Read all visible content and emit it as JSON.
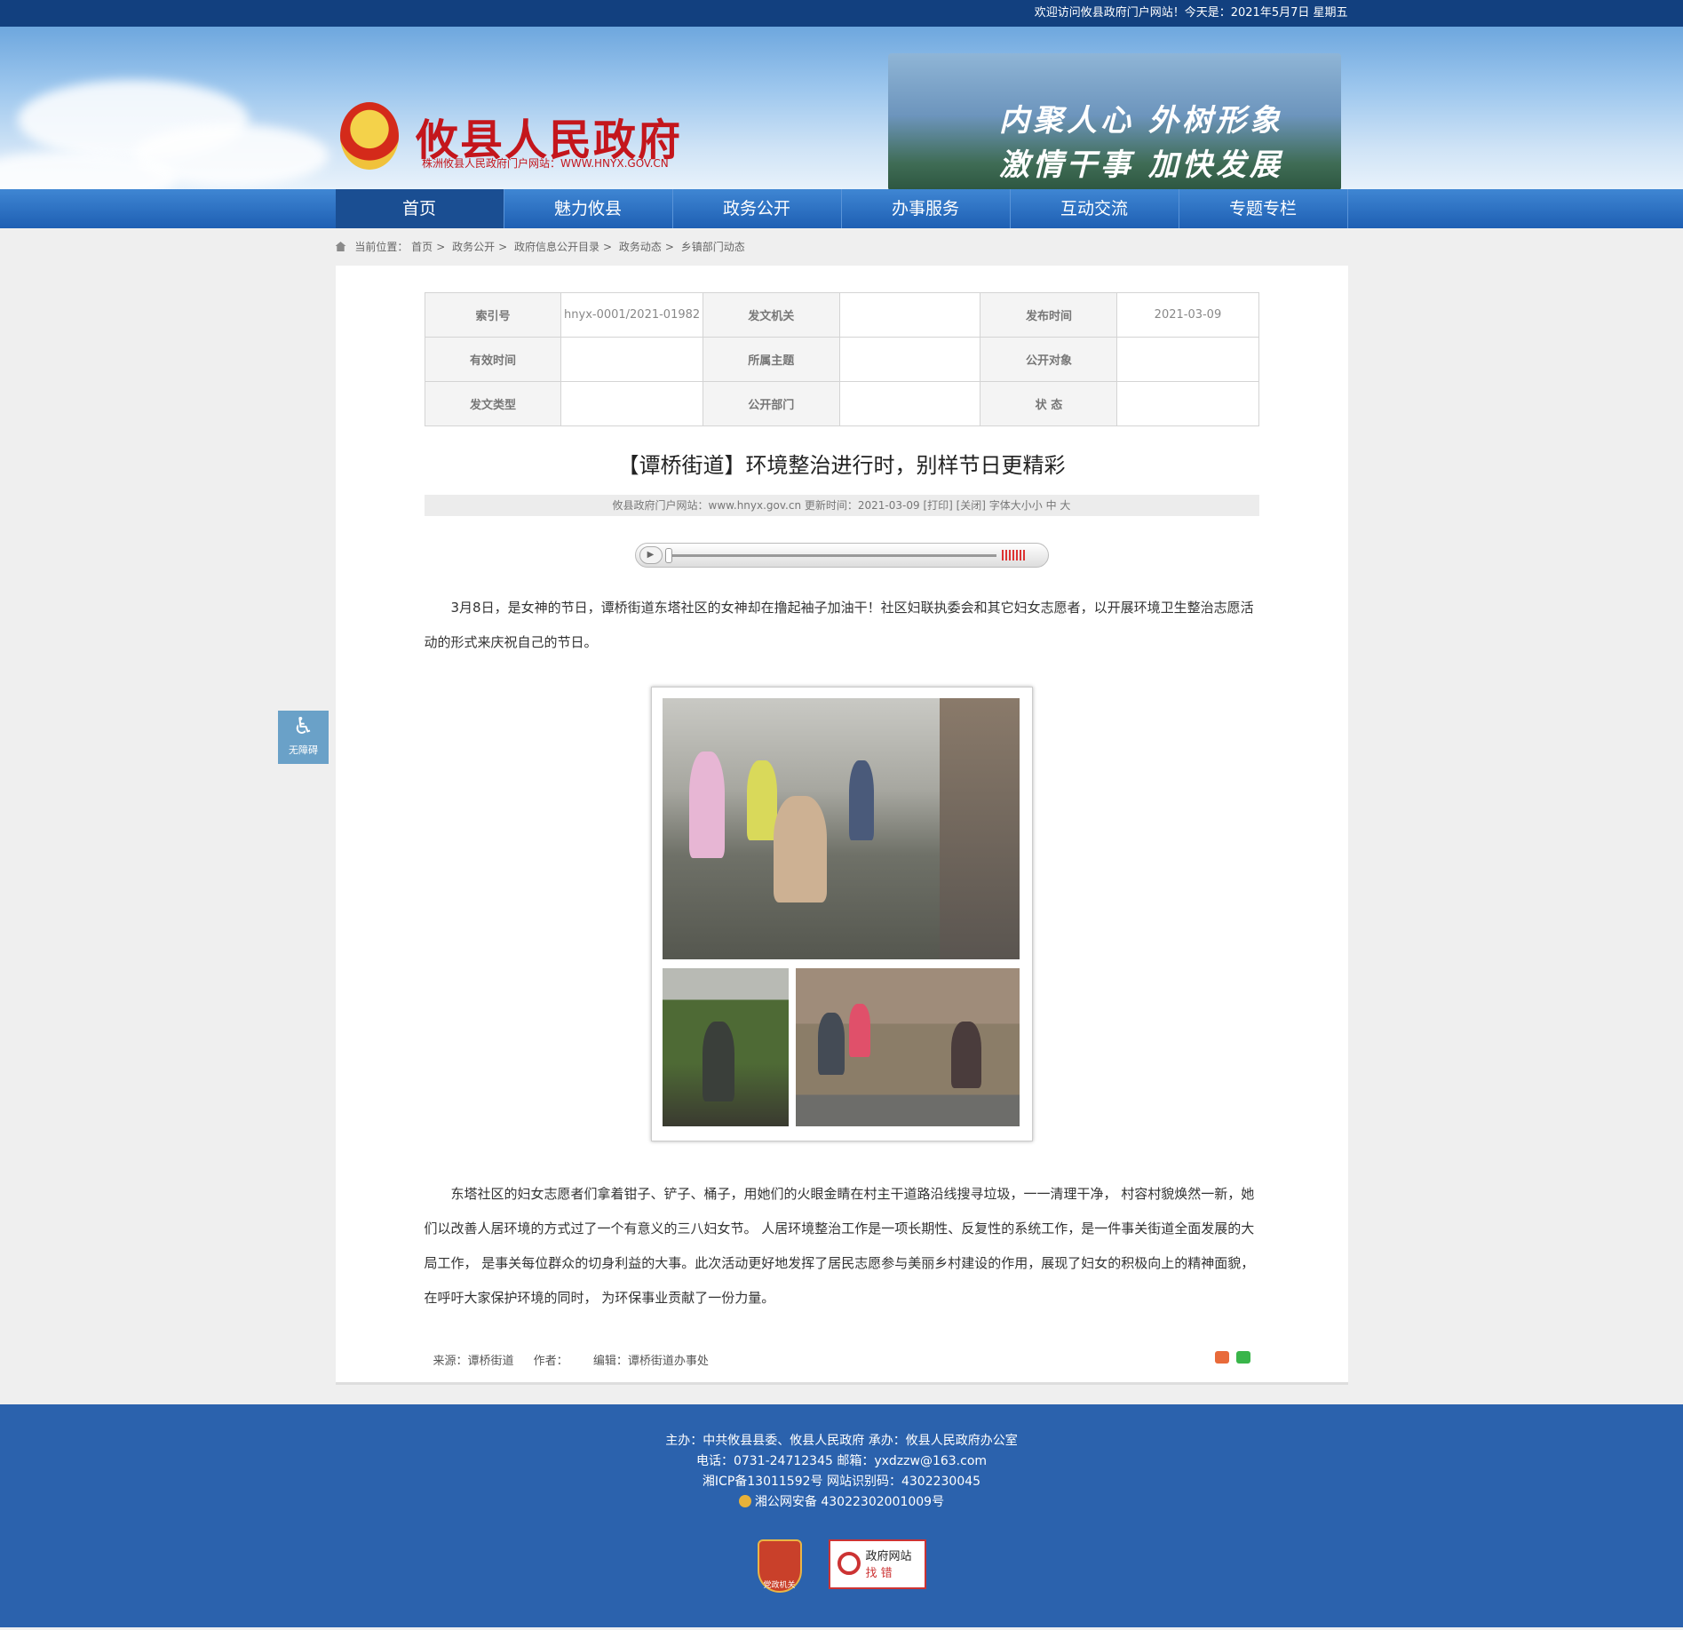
{
  "topbar": {
    "welcome": "欢迎访问攸县政府门户网站！今天是：2021年5月7日 星期五"
  },
  "header": {
    "title": "攸县人民政府",
    "subtitle": "株洲攸县人民政府门户网站：WWW.HNYX.GOV.CN",
    "slogan_line1": "内聚人心 外树形象",
    "slogan_line2": "激情干事 加快发展"
  },
  "nav": {
    "items": [
      "首页",
      "魅力攸县",
      "政务公开",
      "办事服务",
      "互动交流",
      "专题专栏"
    ],
    "active": "首页"
  },
  "breadcrumb": {
    "label": "当前位置：",
    "items": [
      "首页",
      "政务公开",
      "政府信息公开目录",
      "政务动态",
      "乡镇部门动态"
    ]
  },
  "meta": {
    "rows": [
      [
        {
          "k": "索引号",
          "v": "hnyx-0001/2021-01982"
        },
        {
          "k": "发文机关",
          "v": ""
        },
        {
          "k": "发布时间",
          "v": "2021-03-09"
        }
      ],
      [
        {
          "k": "有效时间",
          "v": ""
        },
        {
          "k": "所属主题",
          "v": ""
        },
        {
          "k": "公开对象",
          "v": ""
        }
      ],
      [
        {
          "k": "发文类型",
          "v": ""
        },
        {
          "k": "公开部门",
          "v": ""
        },
        {
          "k": "状 态",
          "v": ""
        }
      ]
    ]
  },
  "article": {
    "title": "【谭桥街道】环境整治进行时，别样节日更精彩",
    "info": "攸县政府门户网站：www.hnyx.gov.cn   更新时间：2021-03-09   [打印] [关闭]   字体大小小 中 大",
    "para1": "3月8日，是女神的节日，谭桥街道东塔社区的女神却在撸起袖子加油干！社区妇联执委会和其它妇女志愿者，以开展环境卫生整治志愿活动的形式来庆祝自己的节日。",
    "para2": "东塔社区的妇女志愿者们拿着钳子、铲子、桶子，用她们的火眼金睛在村主干道路沿线搜寻垃圾，一一清理干净， 村容村貌焕然一新，她们以改善人居环境的方式过了一个有意义的三八妇女节。 人居环境整治工作是一项长期性、反复性的系统工作，是一件事关街道全面发展的大局工作， 是事关每位群众的切身利益的大事。此次活动更好地发挥了居民志愿参与美丽乡村建设的作用，展现了妇女的积极向上的精神面貌，在呼吁大家保护环境的同时， 为环保事业贡献了一份力量。",
    "source": "来源：谭桥街道",
    "author": "作者：",
    "editor": "编辑：谭桥街道办事处"
  },
  "player": {
    "play_symbol": "▶"
  },
  "a11y": {
    "icon": "♿",
    "label": "无障碍"
  },
  "footer": {
    "line1": "主办：中共攸县县委、攸县人民政府 承办：攸县人民政府办公室",
    "line2": "电话：0731-24712345 邮箱：yxdzzw@163.com",
    "line3": "湘ICP备13011592号   网站识别码：4302230045",
    "line4": "湘公网安备 43022302001009号",
    "badge1": "党政机关",
    "badge2_top": "政府网站",
    "badge2_bottom": "找 错"
  },
  "colors": {
    "brand_red": "#c4161c",
    "nav_blue": "#1e5fb3",
    "footer_blue": "#2b62ad"
  }
}
